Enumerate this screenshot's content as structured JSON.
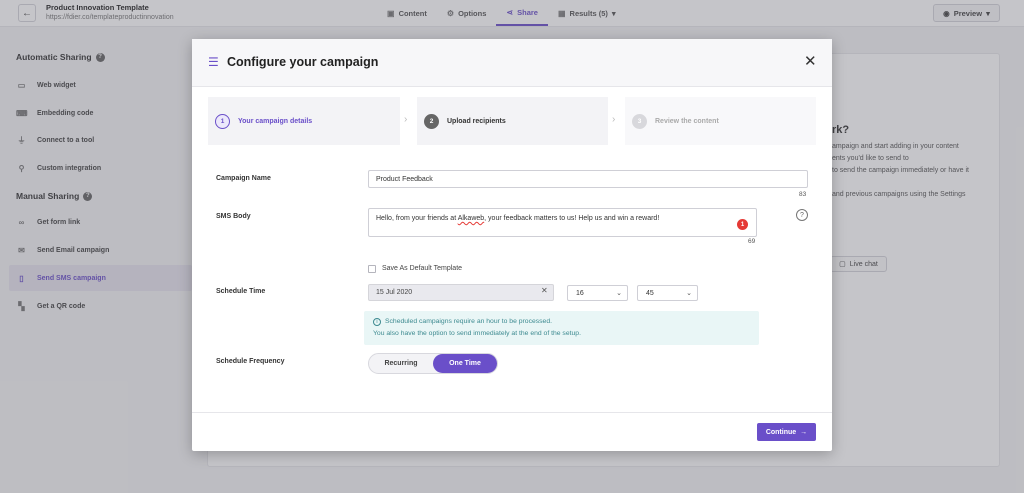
{
  "topbar": {
    "back_icon": "arrow-left-icon",
    "title": "Product Innovation Template",
    "url": "https://fdier.co/templateproductinnovation",
    "tabs": [
      {
        "label": "Content",
        "icon": "content-icon",
        "active": false
      },
      {
        "label": "Options",
        "icon": "options-icon",
        "active": false
      },
      {
        "label": "Share",
        "icon": "share-icon",
        "active": true
      },
      {
        "label": "Results (5)",
        "icon": "results-icon",
        "active": false
      }
    ],
    "preview_label": "Preview"
  },
  "sidebar": {
    "automatic_title": "Automatic Sharing",
    "automatic_items": [
      {
        "label": "Web widget",
        "icon": "web-widget-icon"
      },
      {
        "label": "Embedding code",
        "icon": "embed-icon"
      },
      {
        "label": "Connect to a tool",
        "icon": "plug-icon"
      },
      {
        "label": "Custom integration",
        "icon": "integration-icon"
      }
    ],
    "manual_title": "Manual Sharing",
    "manual_items": [
      {
        "label": "Get form link",
        "icon": "link-icon"
      },
      {
        "label": "Send Email campaign",
        "icon": "email-icon"
      },
      {
        "label": "Send SMS campaign",
        "icon": "phone-icon",
        "active": true
      },
      {
        "label": "Get a QR code",
        "icon": "qr-code-icon"
      }
    ]
  },
  "background": {
    "heading": "rk?",
    "lines": [
      "ampaign and start adding in your content",
      "ents you'd like to send to",
      "to send the campaign immediately or have it",
      "and previous campaigns using the Settings"
    ],
    "live_chat": "Live chat"
  },
  "modal": {
    "title": "Configure your campaign",
    "title_icon": "sliders-icon",
    "close_icon": "close-icon",
    "steps": [
      {
        "number": "1",
        "label": "Your campaign details",
        "state": "active"
      },
      {
        "number": "2",
        "label": "Upload recipients",
        "state": "normal"
      },
      {
        "number": "3",
        "label": "Review the content",
        "state": "disabled"
      }
    ],
    "campaign_name_label": "Campaign Name",
    "campaign_name_value": "Product Feedback",
    "campaign_name_counter": "83",
    "sms_body_label": "SMS Body",
    "sms_body_before": "Hello, from your friends at ",
    "sms_body_misspelled": "Alkaweb",
    "sms_body_after": ", your feedback matters to us! Help us and win a reward!",
    "sms_error_count": "1",
    "sms_counter": "69",
    "save_default_label": "Save As Default Template",
    "schedule_time_label": "Schedule Time",
    "date_value": "15 Jul 2020",
    "hour_value": "16",
    "minute_value": "45",
    "info_line1": "Scheduled campaigns require an hour to be processed.",
    "info_line2": "You also have the option to send immediately at the end of the setup.",
    "frequency_label": "Schedule Frequency",
    "frequency_options": [
      "Recurring",
      "One Time"
    ],
    "frequency_selected": "One Time",
    "continue_label": "Continue"
  },
  "colors": {
    "accent": "#6a4fc9",
    "info_bg": "#e9f6f6",
    "info_text": "#3d8a90",
    "error": "#e53935"
  }
}
